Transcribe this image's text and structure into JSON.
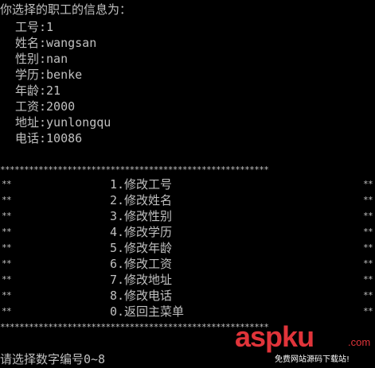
{
  "header": {
    "title": "你选择的职工的信息为："
  },
  "employee": {
    "id_line": "工号:1",
    "name_line": "姓名:wangsan",
    "gender_line": "性别:nan",
    "education_line": "学历:benke",
    "age_line": "年龄:21",
    "salary_line": "工资:2000",
    "address_line": "地址:yunlongqu",
    "phone_line": "电话:10086"
  },
  "menu": {
    "border": "********************************************************",
    "edge": "**",
    "items": [
      "1.修改工号",
      "2.修改姓名",
      "3.修改性别",
      "4.修改学历",
      "5.修改年龄",
      "6.修改工资",
      "7.修改地址",
      "8.修改电话",
      "0.返回主菜单"
    ]
  },
  "prompt": {
    "text": "请选择数字编号0~8"
  },
  "watermark": {
    "brand_main": "asp",
    "brand_ku": "ku",
    "brand_tld": ".com",
    "subtitle": "免费网站源码下载站!"
  },
  "colors": {
    "background": "#000000",
    "text": "#c0c0c0",
    "watermark_red": "#e0343a"
  }
}
